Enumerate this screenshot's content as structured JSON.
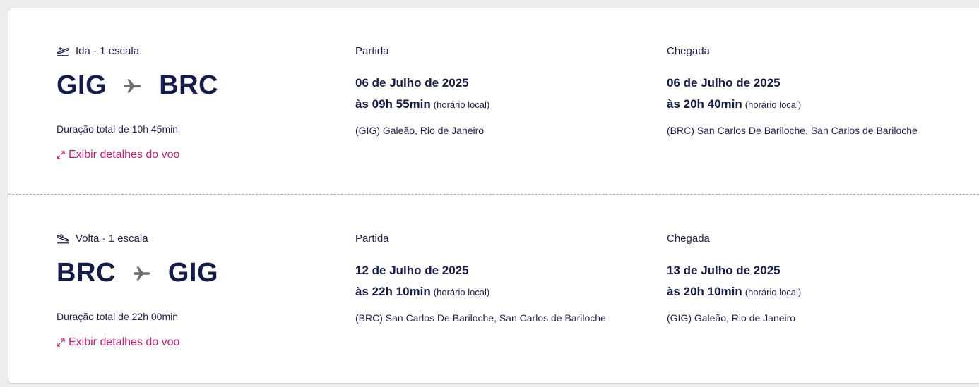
{
  "legs": [
    {
      "label": "Ida · 1 escala",
      "direction_icon": "plane-departure-icon",
      "origin": "GIG",
      "destination": "BRC",
      "duration": "Duração total de 10h 45min",
      "details_link": "Exibir detalhes do voo",
      "departure": {
        "title": "Partida",
        "date": "06 de Julho de 2025",
        "time": "às 09h 55min",
        "tz_note": "(horário local)",
        "airport": "(GIG) Galeão, Rio de Janeiro"
      },
      "arrival": {
        "title": "Chegada",
        "date": "06 de Julho de 2025",
        "time": "às 20h 40min",
        "tz_note": "(horário local)",
        "airport": "(BRC) San Carlos De Bariloche, San Carlos de Bariloche"
      }
    },
    {
      "label": "Volta · 1 escala",
      "direction_icon": "plane-landing-icon",
      "origin": "BRC",
      "destination": "GIG",
      "duration": "Duração total de 22h 00min",
      "details_link": "Exibir detalhes do voo",
      "departure": {
        "title": "Partida",
        "date": "12 de Julho de 2025",
        "time": "às 22h 10min",
        "tz_note": "(horário local)",
        "airport": "(BRC) San Carlos De Bariloche, San Carlos de Bariloche"
      },
      "arrival": {
        "title": "Chegada",
        "date": "13 de Julho de 2025",
        "time": "às 20h 10min",
        "tz_note": "(horário local)",
        "airport": "(GIG) Galeão, Rio de Janeiro"
      }
    }
  ],
  "colors": {
    "text": "#1b2050",
    "link": "#d3176a",
    "route_icon": "#6f6f6f"
  }
}
